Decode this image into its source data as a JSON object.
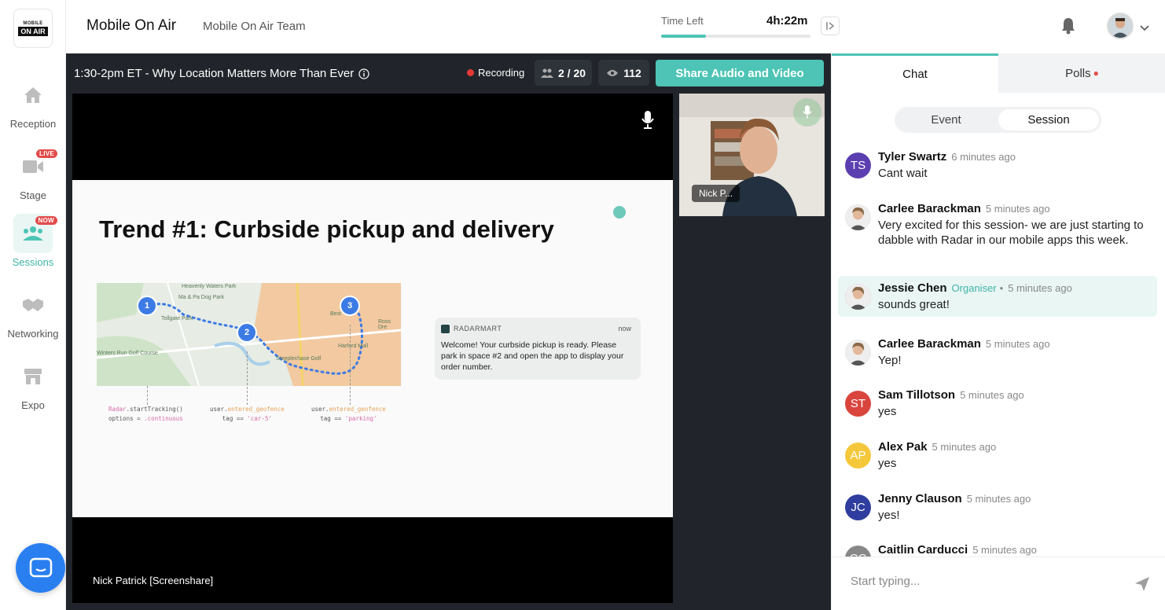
{
  "sidebar": {
    "logo": {
      "line1": "MOBILE",
      "line2": "ON AIR"
    },
    "items": [
      {
        "label": "Reception",
        "icon": "home-icon",
        "badge": ""
      },
      {
        "label": "Stage",
        "icon": "video-camera-icon",
        "badge": "LIVE"
      },
      {
        "label": "Sessions",
        "icon": "sessions-icon",
        "badge": "NOW",
        "active": true
      },
      {
        "label": "Networking",
        "icon": "handshake-icon",
        "badge": ""
      },
      {
        "label": "Expo",
        "icon": "store-icon",
        "badge": ""
      }
    ]
  },
  "header": {
    "event_title": "Mobile On Air",
    "team_name": "Mobile On Air Team",
    "time_left_label": "Time Left",
    "time_left_value": "4h:22m",
    "time_progress": 0.3
  },
  "stage": {
    "session_title": "1:30-2pm ET - Why Location Matters More Than Ever",
    "recording_label": "Recording",
    "speakers_count": "2 / 20",
    "viewers_count": "112",
    "share_button": "Share Audio and Video",
    "main_speaker_label": "Nick Patrick [Screenshare]",
    "side_speaker_label": "Nick P...",
    "slide": {
      "title": "Trend #1: Curbside pickup and delivery",
      "map_labels": [
        "Heavenly Waters Park",
        "Ma & Pa Dog Park",
        "Tollgate Park",
        "Winters Run Golf Course",
        "Best",
        "Ross Dre",
        "Harford Mall",
        "Steeplechase Golf"
      ],
      "pins": [
        "1",
        "2",
        "3"
      ],
      "code": [
        {
          "line1_a": "Radar",
          "line1_b": ".startTracking()",
          "line2_a": "options = ",
          "line2_b": ".continuous"
        },
        {
          "line1_a": "user.",
          "line1_b": "entered_geofence",
          "line2_a": "tag == ",
          "line2_b": "'car-5'"
        },
        {
          "line1_a": "user.",
          "line1_b": "entered_geofence",
          "line2_a": "tag == ",
          "line2_b": "'parking'"
        }
      ],
      "notification": {
        "app": "RADARMART",
        "time": "now",
        "body": "Welcome! Your curbside pickup is ready. Please park in space #2 and open the app to display your order number."
      }
    }
  },
  "chat": {
    "tabs": {
      "chat": "Chat",
      "polls": "Polls"
    },
    "segments": {
      "event": "Event",
      "session": "Session"
    },
    "messages": [
      {
        "initials": "TS",
        "color": "#5b3fb0",
        "name": "Tyler Swartz",
        "role": "",
        "time": "6 minutes ago",
        "text": "Cant wait"
      },
      {
        "initials": "",
        "color": "#cdbfae",
        "name": "Carlee Barackman",
        "role": "",
        "time": "5 minutes ago",
        "text": "Very excited for this session- we are just starting to dabble with Radar in our mobile apps this week."
      },
      {
        "initials": "",
        "color": "#b08666",
        "name": "Jessie Chen",
        "role": "Organiser",
        "time": "5 minutes ago",
        "text": "sounds great!"
      },
      {
        "initials": "",
        "color": "#cdbfae",
        "name": "Carlee Barackman",
        "role": "",
        "time": "5 minutes ago",
        "text": "Yep!"
      },
      {
        "initials": "ST",
        "color": "#d9453d",
        "name": "Sam Tillotson",
        "role": "",
        "time": "5 minutes ago",
        "text": "yes"
      },
      {
        "initials": "AP",
        "color": "#f5c83b",
        "name": "Alex Pak",
        "role": "",
        "time": "5 minutes ago",
        "text": "yes"
      },
      {
        "initials": "JC",
        "color": "#2f3e9e",
        "name": "Jenny Clauson",
        "role": "",
        "time": "5 minutes ago",
        "text": "yes!"
      },
      {
        "initials": "CC",
        "color": "#888888",
        "name": "Caitlin Carducci",
        "role": "",
        "time": "5 minutes ago",
        "text": ""
      }
    ],
    "input_placeholder": "Start typing..."
  }
}
